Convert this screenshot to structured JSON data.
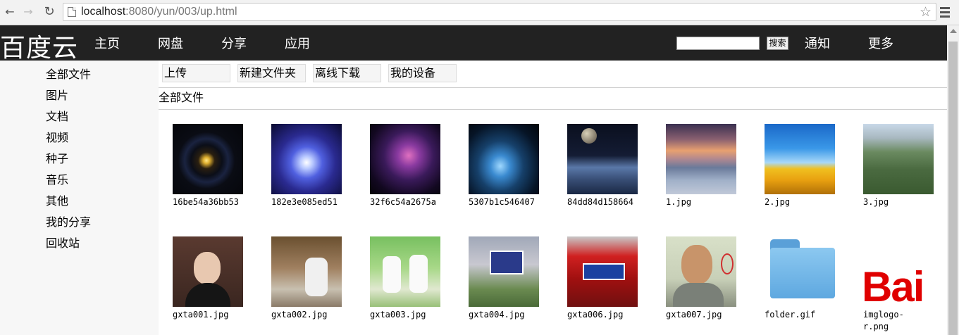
{
  "browser": {
    "url_host": "localhost",
    "url_path": ":8080/yun/003/up.html"
  },
  "header": {
    "logo": "百度云",
    "nav": [
      "主页",
      "网盘",
      "分享",
      "应用"
    ],
    "search_button": "搜索",
    "right_nav": [
      "通知",
      "更多"
    ]
  },
  "sidebar": {
    "items": [
      "全部文件",
      "图片",
      "文档",
      "视频",
      "种子",
      "音乐",
      "其他",
      "我的分享",
      "回收站"
    ]
  },
  "toolbar": {
    "buttons": [
      "上传",
      "新建文件夹",
      "离线下载",
      "我的设备"
    ]
  },
  "breadcrumb": "全部文件",
  "files": [
    {
      "name": "16be54a36bb53",
      "icon": "galaxy-ring-image"
    },
    {
      "name": "182e3e085ed51",
      "icon": "blue-nebula-image"
    },
    {
      "name": "32f6c54a2675a",
      "icon": "purple-nebula-image"
    },
    {
      "name": "5307b1c546407",
      "icon": "deep-space-image"
    },
    {
      "name": "84dd84d158664",
      "icon": "planet-horizon-image"
    },
    {
      "name": "1.jpg",
      "icon": "sunset-sea-image"
    },
    {
      "name": "2.jpg",
      "icon": "sunflower-field-image"
    },
    {
      "name": "3.jpg",
      "icon": "mountain-ruins-image"
    },
    {
      "name": "gxta001.jpg",
      "icon": "person-photo-image"
    },
    {
      "name": "gxta002.jpg",
      "icon": "person-desk-image"
    },
    {
      "name": "gxta003.jpg",
      "icon": "couple-photo-image"
    },
    {
      "name": "gxta004.jpg",
      "icon": "sign-board-image"
    },
    {
      "name": "gxta006.jpg",
      "icon": "car-plate-image"
    },
    {
      "name": "gxta007.jpg",
      "icon": "man-portrait-image"
    },
    {
      "name": "folder.gif",
      "icon": "folder-icon"
    },
    {
      "name": "imglogo-r.png",
      "icon": "baidu-logo-image",
      "logo_text": "Bai"
    }
  ]
}
